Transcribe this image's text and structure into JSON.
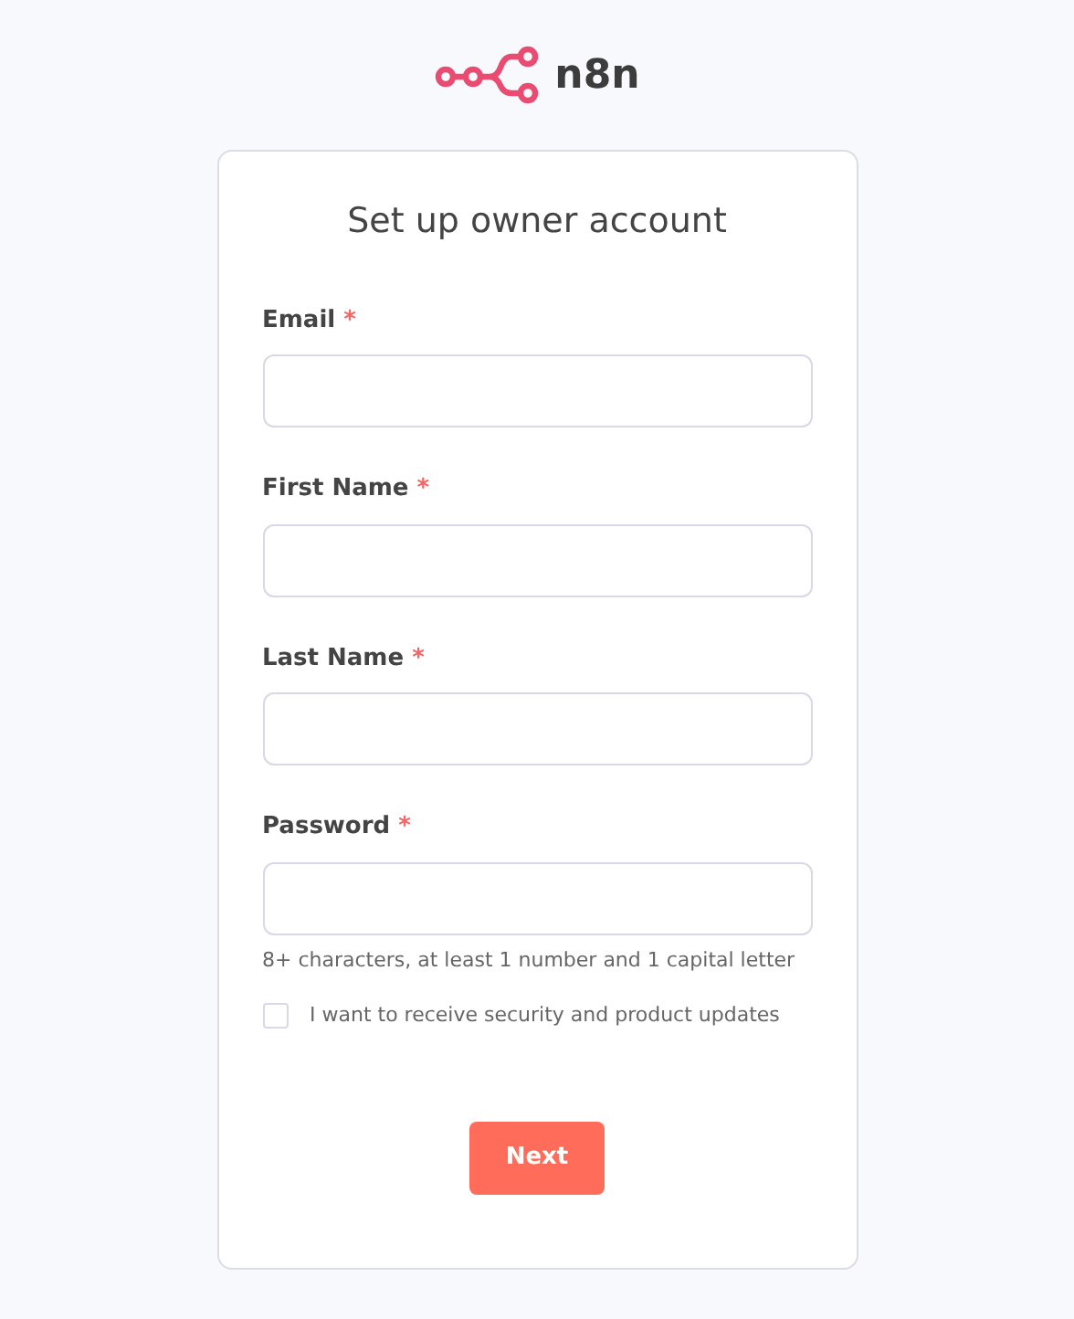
{
  "logo": {
    "text": "n8n"
  },
  "card": {
    "title": "Set up owner account",
    "fields": [
      {
        "label": "Email",
        "required_mark": "*"
      },
      {
        "label": "First Name",
        "required_mark": "*"
      },
      {
        "label": "Last Name",
        "required_mark": "*"
      },
      {
        "label": "Password",
        "required_mark": "*",
        "hint": "8+ characters, at least 1 number and 1 capital letter"
      }
    ],
    "checkbox": {
      "label": "I want to receive security and product updates",
      "checked": false
    },
    "button": "Next"
  }
}
